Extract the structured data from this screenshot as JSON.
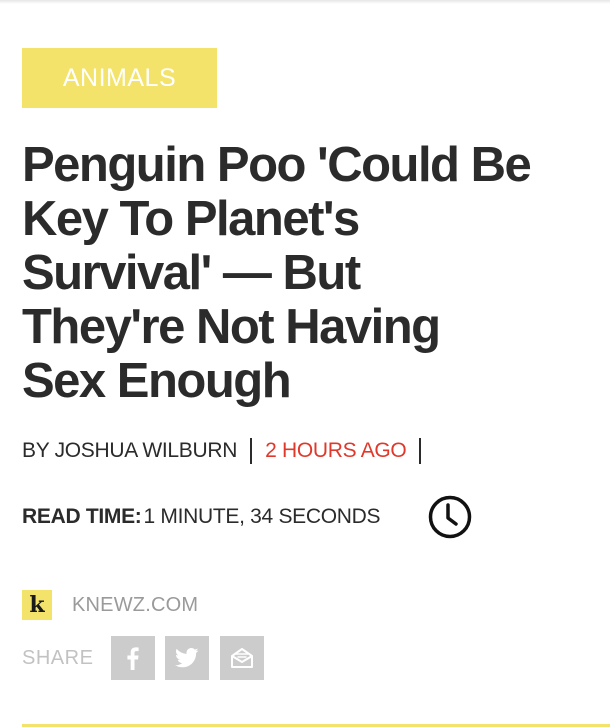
{
  "article": {
    "category": "ANIMALS",
    "headline_lines": [
      "Penguin Poo 'Could Be",
      "Key To Planet's",
      "Survival' — But",
      "They're Not Having",
      "Sex Enough"
    ],
    "byline": {
      "author": "BY JOSHUA WILBURN",
      "time_ago": "2 HOURS AGO"
    },
    "read_time": {
      "label": "READ TIME:",
      "value": "1 MINUTE, 34 SECONDS",
      "icon": "clock-icon"
    },
    "source": {
      "logo_letter": "k",
      "name": "KNEWZ.COM"
    },
    "share": {
      "label": "SHARE",
      "buttons": [
        {
          "icon": "facebook-icon"
        },
        {
          "icon": "twitter-icon"
        },
        {
          "icon": "email-icon"
        }
      ]
    }
  },
  "colors": {
    "accent_yellow": "#f3e36b",
    "time_red": "#e0392b",
    "text_dark": "#2b2b2b",
    "muted_gray": "#9a9a9a",
    "share_gray": "#cccccc"
  }
}
